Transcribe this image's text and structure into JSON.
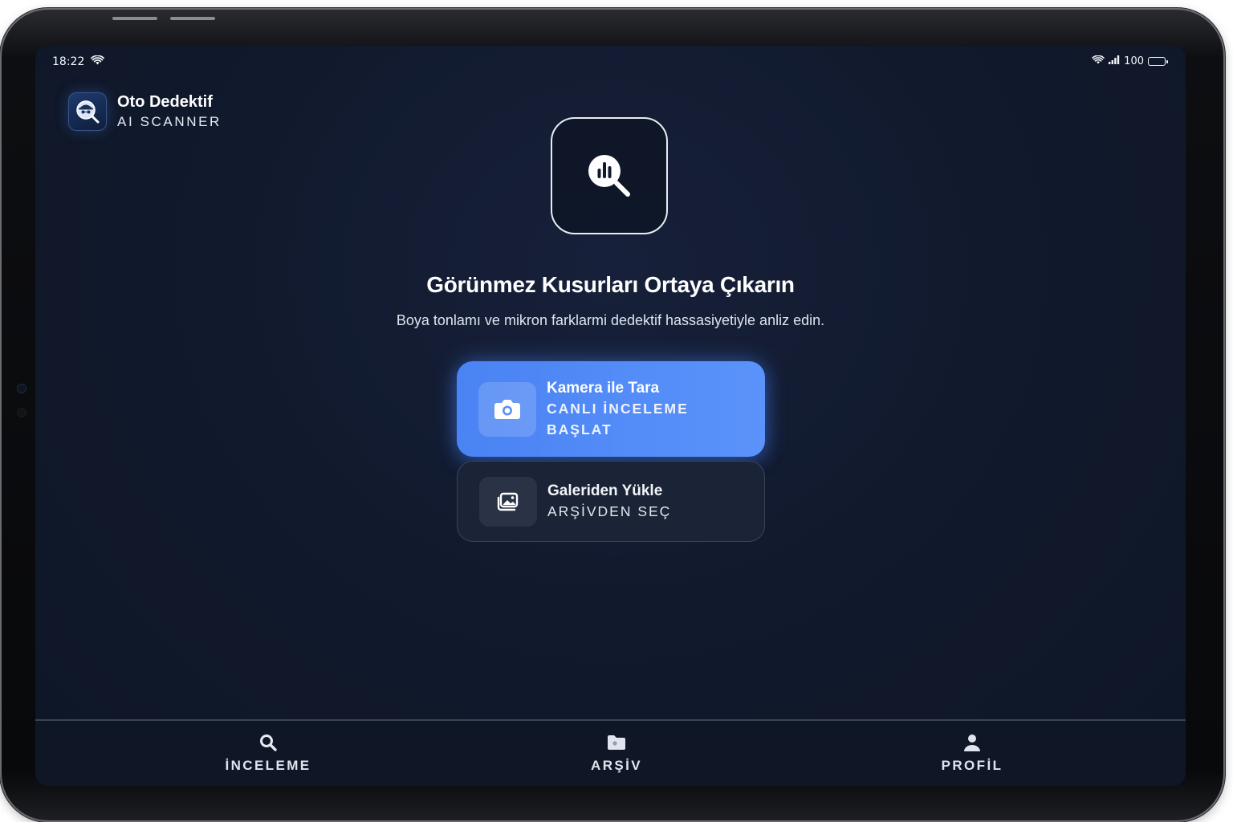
{
  "status_bar": {
    "time": "18:22",
    "battery": "100"
  },
  "brand": {
    "title": "Oto Dedektif",
    "subtitle": "AI SCANNER",
    "logo_icon": "detective-magnifier-icon"
  },
  "hero": {
    "icon": "search-analytics-icon",
    "headline": "Görünmez Kusurları Ortaya Çıkarın",
    "subline": "Boya tonlamı ve mikron farklarmi dedektif hassasiyetiyle anliz edin."
  },
  "actions": {
    "camera": {
      "title": "Kamera ile Tara",
      "subtitle_line1": "CANLI İNCELEME",
      "subtitle_line2": "BAŞLAT",
      "icon": "camera-icon"
    },
    "gallery": {
      "title": "Galeriden Yükle",
      "subtitle": "ARŞİVDEN SEÇ",
      "icon": "gallery-icon"
    }
  },
  "tabs": [
    {
      "label": "İNCELEME",
      "icon": "search-icon"
    },
    {
      "label": "ARŞİV",
      "icon": "folder-icon"
    },
    {
      "label": "PROFİL",
      "icon": "user-icon"
    }
  ],
  "colors": {
    "accent": "#4a83f3",
    "background": "#111a2d",
    "card_dark": "#1b2436"
  }
}
